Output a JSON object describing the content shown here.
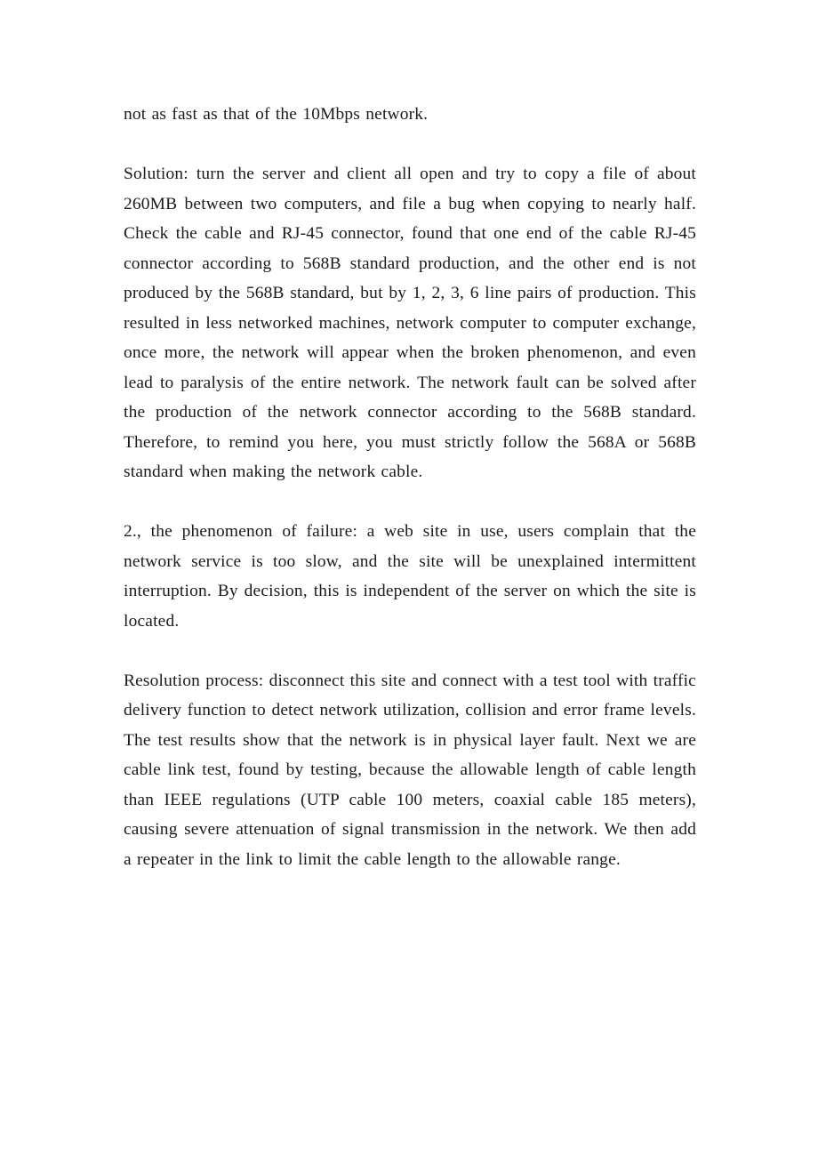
{
  "document": {
    "page_background": "#ffffff",
    "text_color": "#1a1a1a",
    "paragraphs": [
      {
        "id": "para-continued-intro",
        "text": "not as fast as that of the 10Mbps network."
      },
      {
        "id": "para-solution",
        "text": "Solution: turn the server and client all open and try to copy a file of about 260MB between two computers, and file a bug when copying to nearly half. Check the cable and RJ-45 connector, found that one end of the cable RJ-45 connector according to 568B standard production, and the other end is not produced by the 568B standard, but by 1, 2, 3, 6 line pairs of production. This resulted in less networked machines, network computer to computer exchange, once more, the network will appear when the broken phenomenon, and even lead to paralysis of the entire network. The network fault can be solved after the production of the network connector according to the 568B standard. Therefore, to remind you here, you must strictly follow the 568A or 568B standard when making the network cable."
      },
      {
        "id": "para-failure-phenomenon-2",
        "text": "2., the phenomenon of failure: a web site in use, users complain that the network service is too slow, and the site will be unexplained intermittent interruption. By decision, this is independent of the server on which the site is located."
      },
      {
        "id": "para-resolution-process",
        "text": "Resolution process: disconnect this site and connect with a test tool with traffic delivery function to detect network utilization, collision and error frame levels. The test results show that the network is in physical layer fault. Next we are cable link test, found by testing, because the allowable length of cable length than IEEE regulations (UTP cable 100 meters, coaxial cable 185 meters), causing severe attenuation of signal transmission in the network. We then add a repeater in the link to limit the cable length to the allowable range."
      }
    ]
  }
}
